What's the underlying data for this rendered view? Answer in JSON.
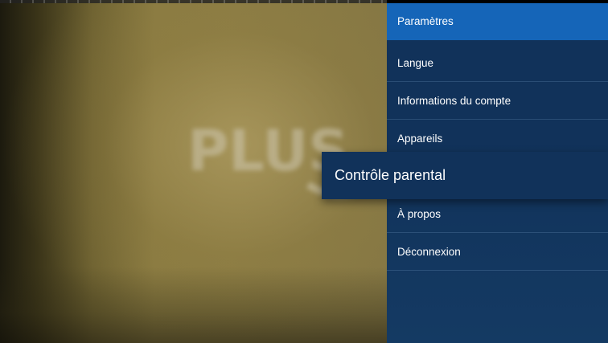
{
  "menu": {
    "title": "Paramètres",
    "items": [
      {
        "label": "Langue"
      },
      {
        "label": "Informations du compte"
      },
      {
        "label": "Appareils"
      },
      {
        "label": "Contrôle parental"
      },
      {
        "label": "À propos"
      },
      {
        "label": "Déconnexion"
      }
    ],
    "focused_index": 3
  },
  "background": {
    "logo_text": "PLUS"
  },
  "colors": {
    "panel": "#11325a",
    "header": "#1565b8",
    "text": "#ffffff"
  }
}
